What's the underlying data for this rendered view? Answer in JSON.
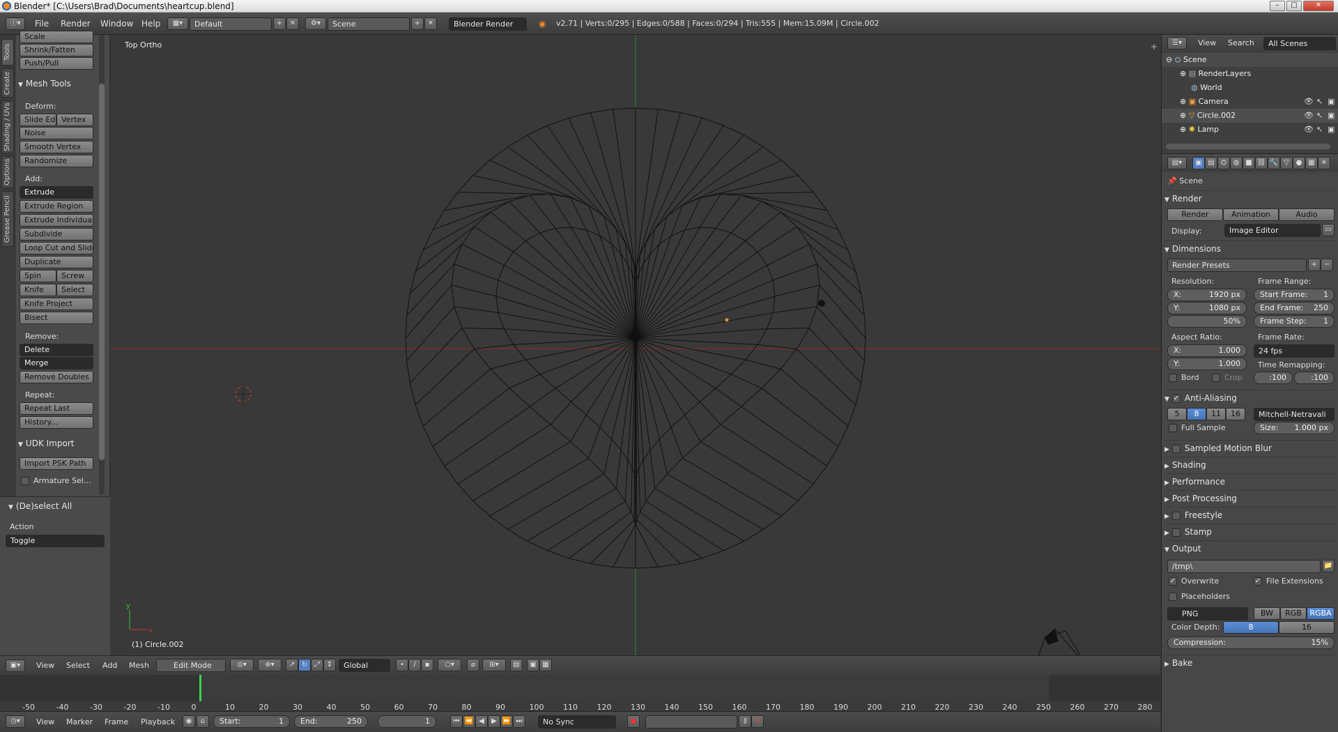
{
  "window": {
    "title": "Blender* [C:\\Users\\Brad\\Documents\\heartcup.blend]"
  },
  "menubar": {
    "file": "File",
    "render": "Render",
    "window": "Window",
    "help": "Help",
    "layout": "Default",
    "scene": "Scene",
    "engine": "Blender Render",
    "stats": "v2.71 | Verts:0/295 | Edges:0/588 | Faces:0/294 | Tris:555 | Mem:15.09M | Circle.002"
  },
  "vtabs": [
    "Tools",
    "Create",
    "Shading / UVs",
    "Options",
    "Grease Pencil"
  ],
  "toolshelf": {
    "scale_label": "Scale",
    "shrink_fatten": "Shrink/Fatten",
    "push_pull": "Push/Pull",
    "mesh_tools_header": "Mesh Tools",
    "deform_label": "Deform:",
    "slide_edge": "Slide Ed",
    "vertex": "Vertex",
    "noise": "Noise",
    "smooth_vertex": "Smooth Vertex",
    "randomize": "Randomize",
    "add_label": "Add:",
    "extrude": "Extrude",
    "extrude_region": "Extrude Region",
    "extrude_individual": "Extrude Individual",
    "subdivide": "Subdivide",
    "loop_cut": "Loop Cut and Slide",
    "duplicate": "Duplicate",
    "spin": "Spin",
    "screw": "Screw",
    "knife": "Knife",
    "select": "Select",
    "knife_project": "Knife Project",
    "bisect": "Bisect",
    "remove_label": "Remove:",
    "delete": "Delete",
    "merge": "Merge",
    "remove_doubles": "Remove Doubles",
    "repeat_label": "Repeat:",
    "repeat_last": "Repeat Last",
    "history": "History...",
    "udk_header": "UDK Import",
    "import_psk": "Import PSK Path",
    "armature_sel": "Armature Sel...",
    "operator_header": "(De)select All",
    "action_label": "Action",
    "action_value": "Toggle"
  },
  "viewport": {
    "view_name": "Top Ortho",
    "object_label": "(1) Circle.002"
  },
  "vp_header": {
    "view": "View",
    "select": "Select",
    "add": "Add",
    "mesh": "Mesh",
    "mode": "Edit Mode",
    "orientation": "Global"
  },
  "timeline": {
    "ticks": [
      "-50",
      "-40",
      "-30",
      "-20",
      "-10",
      "0",
      "10",
      "20",
      "30",
      "40",
      "50",
      "60",
      "70",
      "80",
      "90",
      "100",
      "110",
      "120",
      "130",
      "140",
      "150",
      "160",
      "170",
      "180",
      "190",
      "200",
      "210",
      "220",
      "230",
      "240",
      "250",
      "260",
      "270",
      "280"
    ],
    "current_frame_marker": 1,
    "view": "View",
    "marker": "Marker",
    "frame": "Frame",
    "playback": "Playback",
    "start_label": "Start:",
    "start_value": "1",
    "end_label": "End:",
    "end_value": "250",
    "current_frame": "1",
    "sync": "No Sync"
  },
  "outliner": {
    "view": "View",
    "search": "Search",
    "filter": "All Scenes",
    "items": [
      {
        "name": "Scene"
      },
      {
        "name": "RenderLayers"
      },
      {
        "name": "World"
      },
      {
        "name": "Camera"
      },
      {
        "name": "Circle.002"
      },
      {
        "name": "Lamp"
      }
    ]
  },
  "props": {
    "context": "Scene",
    "render_header": "Render",
    "render_btn": "Render",
    "animation_btn": "Animation",
    "audio_btn": "Audio",
    "display_label": "Display:",
    "display_value": "Image Editor",
    "dimensions_header": "Dimensions",
    "render_presets": "Render Presets",
    "resolution_label": "Resolution:",
    "res_x_label": "X:",
    "res_x": "1920 px",
    "res_y_label": "Y:",
    "res_y": "1080 px",
    "res_pct": "50%",
    "frame_range_label": "Frame Range:",
    "start_frame_label": "Start Frame:",
    "start_frame": "1",
    "end_frame_label": "End Frame:",
    "end_frame": "250",
    "frame_step_label": "Frame Step:",
    "frame_step": "1",
    "aspect_label": "Aspect Ratio:",
    "asp_x_label": "X:",
    "asp_x": "1.000",
    "asp_y_label": "Y:",
    "asp_y": "1.000",
    "frame_rate_label": "Frame Rate:",
    "frame_rate": "24 fps",
    "time_remap_label": "Time Remapping:",
    "remap_old": ":100",
    "remap_new": ":100",
    "bord": "Bord",
    "crop": "Crop",
    "aa_header": "Anti-Aliasing",
    "aa_samples": [
      "5",
      "8",
      "11",
      "16"
    ],
    "aa_selected": "8",
    "aa_filter": "Mitchell-Netravali",
    "full_sample": "Full Sample",
    "size_label": "Size:",
    "size_value": "1.000 px",
    "motion_blur": "Sampled Motion Blur",
    "shading": "Shading",
    "performance": "Performance",
    "post_processing": "Post Processing",
    "freestyle": "Freestyle",
    "stamp": "Stamp",
    "output_header": "Output",
    "output_path": "/tmp\\",
    "overwrite": "Overwrite",
    "file_extensions": "File Extensions",
    "placeholders": "Placeholders",
    "format": "PNG",
    "bw": "BW",
    "rgb": "RGB",
    "rgba": "RGBA",
    "color_depth_label": "Color Depth:",
    "depth_8": "8",
    "depth_16": "16",
    "compression_label": "Compression:",
    "compression_value": "15%",
    "bake": "Bake"
  },
  "colors": {
    "accent": "#5680c2",
    "x_axis": "#8c2a2a",
    "y_axis": "#2f8a2f",
    "mesh": "#111111"
  }
}
